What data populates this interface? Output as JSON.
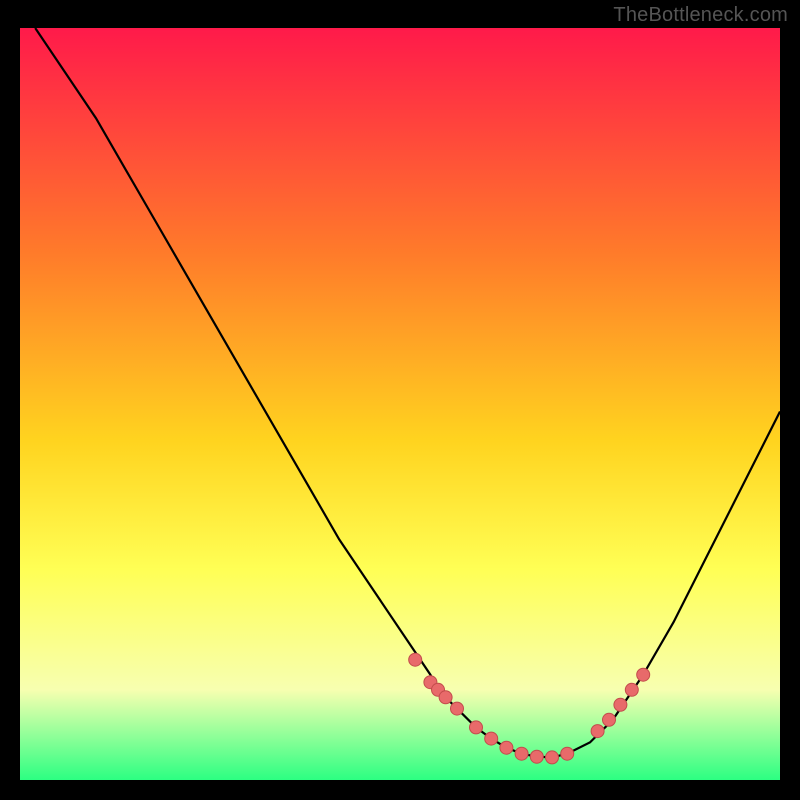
{
  "watermark": "TheBottleneck.com",
  "colors": {
    "page_bg": "#000000",
    "gradient_top": "#ff1a4a",
    "gradient_mid1": "#ff7b2a",
    "gradient_mid2": "#ffd41f",
    "gradient_mid3": "#ffff55",
    "gradient_low": "#f7ffb0",
    "gradient_bottom": "#2cff82",
    "curve": "#000000",
    "dot_fill": "#e86a6a",
    "dot_stroke": "#c24c4c"
  },
  "chart_data": {
    "type": "line",
    "title": "",
    "xlabel": "",
    "ylabel": "",
    "xlim": [
      0,
      100
    ],
    "ylim": [
      0,
      100
    ],
    "series": [
      {
        "name": "bottleneck-curve",
        "x": [
          2,
          6,
          10,
          14,
          18,
          22,
          26,
          30,
          34,
          38,
          42,
          46,
          50,
          54,
          55,
          56,
          58,
          60,
          62,
          64,
          66,
          68,
          70,
          72,
          75,
          78,
          82,
          86,
          90,
          94,
          98,
          100
        ],
        "y": [
          100,
          94,
          88,
          81,
          74,
          67,
          60,
          53,
          46,
          39,
          32,
          26,
          20,
          14,
          12,
          11,
          9,
          7,
          5.5,
          4.3,
          3.5,
          3.1,
          3.0,
          3.5,
          5,
          8,
          14,
          21,
          29,
          37,
          45,
          49
        ]
      }
    ],
    "dots": {
      "name": "highlight-dots",
      "x": [
        52,
        54,
        55,
        56,
        57.5,
        60,
        62,
        64,
        66,
        68,
        70,
        72,
        76,
        77.5,
        79,
        80.5,
        82
      ],
      "y": [
        16,
        13,
        12,
        11,
        9.5,
        7,
        5.5,
        4.3,
        3.5,
        3.1,
        3.0,
        3.5,
        6.5,
        8,
        10,
        12,
        14
      ]
    }
  }
}
